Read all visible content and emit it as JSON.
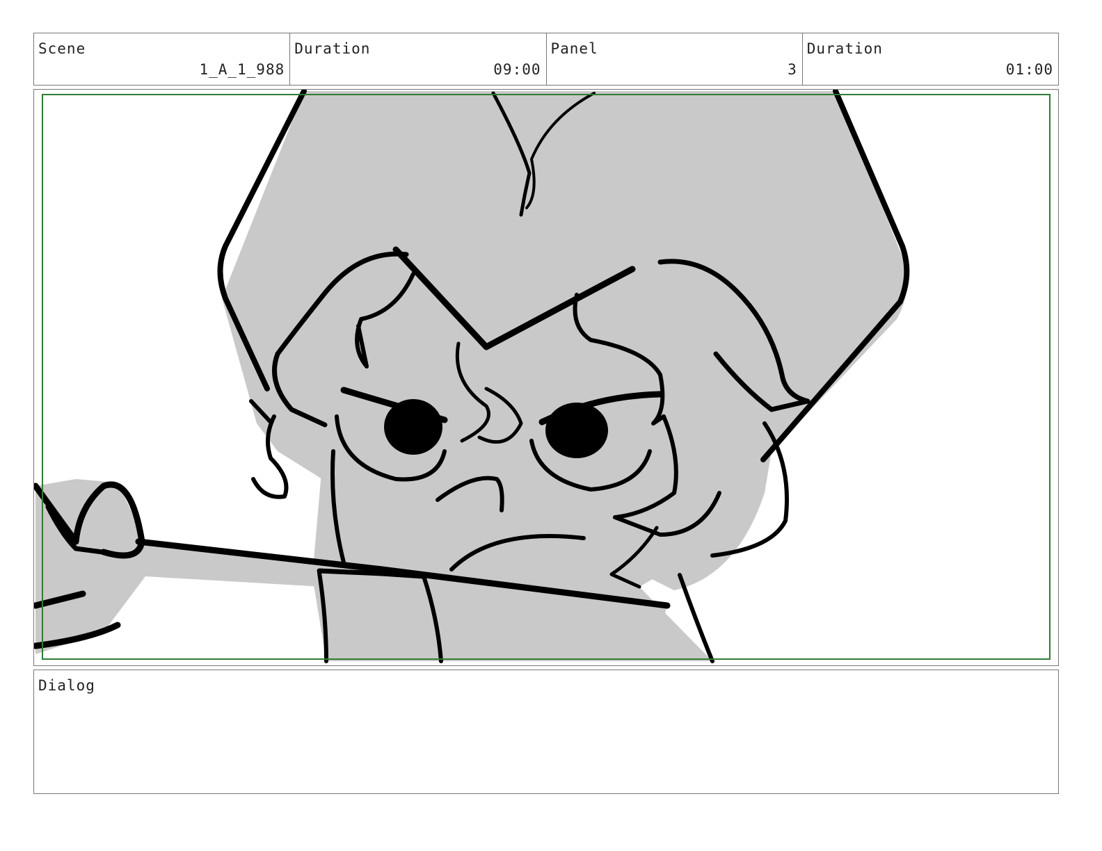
{
  "header": {
    "scene_label": "Scene",
    "scene_value": "1_A_1_988",
    "duration_label": "Duration",
    "duration_value": "09:00",
    "panel_label": "Panel",
    "panel_value": "3",
    "panel_duration_label": "Duration",
    "panel_duration_value": "01:00"
  },
  "dialog": {
    "label": "Dialog",
    "text": ""
  },
  "colors": {
    "frame_border": "#777777",
    "safe_area": "#2e7d32",
    "fill_gray": "#c9c9c9",
    "ink": "#000000"
  }
}
